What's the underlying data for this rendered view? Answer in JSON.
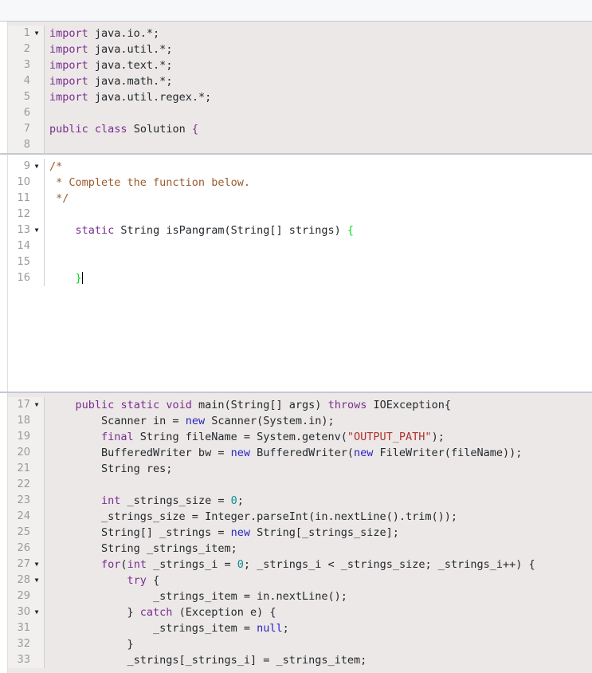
{
  "header": {
    "title": ""
  },
  "colors": {
    "readonly_background": "#ebe8e7",
    "editable_background": "#ffffff",
    "gutter_readonly": "#f2f0ef",
    "gutter_editable": "#ffffff",
    "divider": "#c3c8d1",
    "line_number": "#9a9a9a",
    "keyword_purple": "#7b2d8e",
    "keyword_blue": "#2a24c4",
    "string_red": "#b1332e",
    "comment_brown": "#9a5b2d",
    "number_teal": "#0f8d8d",
    "bracket_match_green": "#00dd22",
    "plain_text": "#24292e"
  },
  "panes": [
    {
      "id": "pane-readonly-top",
      "name": "readonly-header-code",
      "editable": false,
      "lines": [
        {
          "no": "1",
          "fold": true,
          "tokens": [
            {
              "t": "import",
              "c": "k"
            },
            {
              "t": " java.io.*;",
              "c": "p"
            }
          ]
        },
        {
          "no": "2",
          "fold": false,
          "tokens": [
            {
              "t": "import",
              "c": "k"
            },
            {
              "t": " java.util.*;",
              "c": "p"
            }
          ]
        },
        {
          "no": "3",
          "fold": false,
          "tokens": [
            {
              "t": "import",
              "c": "k"
            },
            {
              "t": " java.text.*;",
              "c": "p"
            }
          ]
        },
        {
          "no": "4",
          "fold": false,
          "tokens": [
            {
              "t": "import",
              "c": "k"
            },
            {
              "t": " java.math.*;",
              "c": "p"
            }
          ]
        },
        {
          "no": "5",
          "fold": false,
          "tokens": [
            {
              "t": "import",
              "c": "k"
            },
            {
              "t": " java.util.regex.*;",
              "c": "p"
            }
          ]
        },
        {
          "no": "6",
          "fold": false,
          "tokens": []
        },
        {
          "no": "7",
          "fold": false,
          "tokens": [
            {
              "t": "public",
              "c": "k"
            },
            {
              "t": " ",
              "c": "p"
            },
            {
              "t": "class",
              "c": "k"
            },
            {
              "t": " Solution ",
              "c": "p"
            },
            {
              "t": "{",
              "c": "br"
            }
          ]
        },
        {
          "no": "8",
          "fold": false,
          "tokens": []
        }
      ]
    },
    {
      "id": "pane-editable",
      "name": "editable-solution-code",
      "editable": true,
      "lines": [
        {
          "no": "9",
          "fold": true,
          "tokens": [
            {
              "t": "/*",
              "c": "c"
            }
          ]
        },
        {
          "no": "10",
          "fold": false,
          "tokens": [
            {
              "t": " * Complete the function below.",
              "c": "c"
            }
          ]
        },
        {
          "no": "11",
          "fold": false,
          "tokens": [
            {
              "t": " */",
              "c": "c"
            }
          ]
        },
        {
          "no": "12",
          "fold": false,
          "tokens": []
        },
        {
          "no": "13",
          "fold": true,
          "tokens": [
            {
              "t": "    ",
              "c": "p"
            },
            {
              "t": "static",
              "c": "k"
            },
            {
              "t": " String isPangram(String[] strings) ",
              "c": "p"
            },
            {
              "t": "{",
              "c": "brg"
            }
          ]
        },
        {
          "no": "14",
          "fold": false,
          "tokens": []
        },
        {
          "no": "15",
          "fold": false,
          "tokens": []
        },
        {
          "no": "16",
          "fold": false,
          "tokens": [
            {
              "t": "    ",
              "c": "p"
            },
            {
              "t": "}",
              "c": "brg"
            }
          ],
          "caret": true
        }
      ]
    },
    {
      "id": "pane-readonly-bottom",
      "name": "readonly-main-code",
      "editable": false,
      "lines": [
        {
          "no": "17",
          "fold": true,
          "tokens": [
            {
              "t": "    ",
              "c": "p"
            },
            {
              "t": "public",
              "c": "k"
            },
            {
              "t": " ",
              "c": "p"
            },
            {
              "t": "static",
              "c": "k"
            },
            {
              "t": " ",
              "c": "p"
            },
            {
              "t": "void",
              "c": "k"
            },
            {
              "t": " main(String[] args) ",
              "c": "p"
            },
            {
              "t": "throws",
              "c": "k"
            },
            {
              "t": " IOException{",
              "c": "p"
            }
          ]
        },
        {
          "no": "18",
          "fold": false,
          "tokens": [
            {
              "t": "        Scanner in = ",
              "c": "p"
            },
            {
              "t": "new",
              "c": "kb"
            },
            {
              "t": " Scanner(System.in);",
              "c": "p"
            }
          ]
        },
        {
          "no": "19",
          "fold": false,
          "tokens": [
            {
              "t": "        ",
              "c": "p"
            },
            {
              "t": "final",
              "c": "k"
            },
            {
              "t": " String fileName = System.getenv(",
              "c": "p"
            },
            {
              "t": "\"OUTPUT_PATH\"",
              "c": "s"
            },
            {
              "t": ");",
              "c": "p"
            }
          ]
        },
        {
          "no": "20",
          "fold": false,
          "tokens": [
            {
              "t": "        BufferedWriter bw = ",
              "c": "p"
            },
            {
              "t": "new",
              "c": "kb"
            },
            {
              "t": " BufferedWriter(",
              "c": "p"
            },
            {
              "t": "new",
              "c": "kb"
            },
            {
              "t": " FileWriter(fileName));",
              "c": "p"
            }
          ]
        },
        {
          "no": "21",
          "fold": false,
          "tokens": [
            {
              "t": "        String res;",
              "c": "p"
            }
          ]
        },
        {
          "no": "22",
          "fold": false,
          "tokens": []
        },
        {
          "no": "23",
          "fold": false,
          "tokens": [
            {
              "t": "        ",
              "c": "p"
            },
            {
              "t": "int",
              "c": "k"
            },
            {
              "t": " _strings_size = ",
              "c": "p"
            },
            {
              "t": "0",
              "c": "n"
            },
            {
              "t": ";",
              "c": "p"
            }
          ]
        },
        {
          "no": "24",
          "fold": false,
          "tokens": [
            {
              "t": "        _strings_size = Integer.parseInt(in.nextLine().trim());",
              "c": "p"
            }
          ]
        },
        {
          "no": "25",
          "fold": false,
          "tokens": [
            {
              "t": "        String[] _strings = ",
              "c": "p"
            },
            {
              "t": "new",
              "c": "kb"
            },
            {
              "t": " String[_strings_size];",
              "c": "p"
            }
          ]
        },
        {
          "no": "26",
          "fold": false,
          "tokens": [
            {
              "t": "        String _strings_item;",
              "c": "p"
            }
          ]
        },
        {
          "no": "27",
          "fold": true,
          "tokens": [
            {
              "t": "        ",
              "c": "p"
            },
            {
              "t": "for",
              "c": "k"
            },
            {
              "t": "(",
              "c": "p"
            },
            {
              "t": "int",
              "c": "k"
            },
            {
              "t": " _strings_i = ",
              "c": "p"
            },
            {
              "t": "0",
              "c": "n"
            },
            {
              "t": "; _strings_i < _strings_size; _strings_i++) {",
              "c": "p"
            }
          ]
        },
        {
          "no": "28",
          "fold": true,
          "tokens": [
            {
              "t": "            ",
              "c": "p"
            },
            {
              "t": "try",
              "c": "k"
            },
            {
              "t": " {",
              "c": "p"
            }
          ]
        },
        {
          "no": "29",
          "fold": false,
          "tokens": [
            {
              "t": "                _strings_item = in.nextLine();",
              "c": "p"
            }
          ]
        },
        {
          "no": "30",
          "fold": true,
          "tokens": [
            {
              "t": "            } ",
              "c": "p"
            },
            {
              "t": "catch",
              "c": "k"
            },
            {
              "t": " (Exception e) {",
              "c": "p"
            }
          ]
        },
        {
          "no": "31",
          "fold": false,
          "tokens": [
            {
              "t": "                _strings_item = ",
              "c": "p"
            },
            {
              "t": "null",
              "c": "kb"
            },
            {
              "t": ";",
              "c": "p"
            }
          ]
        },
        {
          "no": "32",
          "fold": false,
          "tokens": [
            {
              "t": "            }",
              "c": "p"
            }
          ]
        },
        {
          "no": "33",
          "fold": false,
          "tokens": [
            {
              "t": "            _strings[_strings_i] = _strings_item;",
              "c": "p"
            }
          ]
        }
      ]
    }
  ]
}
